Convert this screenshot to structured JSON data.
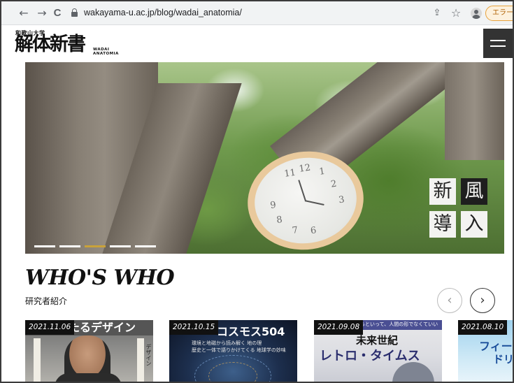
{
  "browser": {
    "url": "wakayama-u.ac.jp/blog/wadai_anatomia/",
    "error_label": "エラー",
    "back_glyph": "←",
    "forward_glyph": "→",
    "reload_glyph": "C",
    "share_glyph": "⇪",
    "star_glyph": "☆",
    "menu_glyph": "⋮"
  },
  "site": {
    "univ_name": "和歌山大学",
    "title": "解体新書",
    "subtitle_line1": "WADAI",
    "subtitle_line2": "ANATOMIA"
  },
  "hero": {
    "kanji": [
      "新",
      "風",
      "導",
      "入"
    ],
    "clock_numbers": [
      "11",
      "12",
      "1",
      "2",
      "3",
      "9",
      "8",
      "7",
      "6"
    ],
    "slides_total": 5,
    "active_slide": 3,
    "accent_color": "#c9a23a"
  },
  "whos_who": {
    "title": "WHO'S WHO",
    "subtitle": "研究者紹介",
    "prev_glyph": "‹",
    "next_glyph": "›",
    "cards": [
      {
        "date": "2021.11.06",
        "headline": "たるデザイン",
        "side_text": "デザイン"
      },
      {
        "date": "2021.10.15",
        "headline": "コスモス504",
        "caption_line1": "環境と地磁から読み解く 地の理",
        "caption_line2": "歴史と一体で語りかけてくる 地球学の妙味"
      },
      {
        "date": "2021.09.08",
        "banner": "らといって、人間の形でなくていい",
        "headline_1": "未来世紀",
        "headline_2": "レトロ・タイムス"
      },
      {
        "date": "2021.08.10",
        "headline": "フィー",
        "headline_2": "ドリ"
      }
    ]
  }
}
